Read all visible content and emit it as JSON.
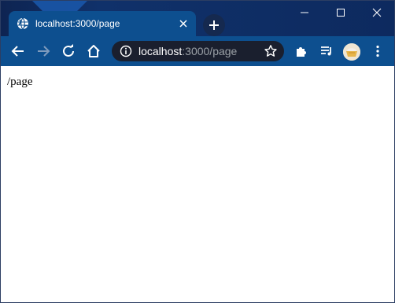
{
  "window": {
    "controls": {
      "minimize_icon": "minimize-icon",
      "maximize_icon": "maximize-icon",
      "close_icon": "close-icon"
    }
  },
  "tab": {
    "title": "localhost:3000/page",
    "favicon": "globe-icon"
  },
  "toolbar": {
    "address": {
      "host": "localhost",
      "rest": ":3000/page"
    },
    "icons": [
      "back-icon",
      "forward-icon",
      "reload-icon",
      "home-icon",
      "site-info-icon",
      "bookmark-star-icon",
      "extensions-icon",
      "media-queue-icon",
      "profile-avatar",
      "menu-icon"
    ]
  },
  "content": {
    "text": "/page"
  },
  "colors": {
    "titlebar": "#0e2452",
    "tab_active": "#0d4f8f",
    "toolbar": "#0d4f8f",
    "omnibox": "#1a1f2e",
    "url_rest": "#9aa0a6"
  }
}
